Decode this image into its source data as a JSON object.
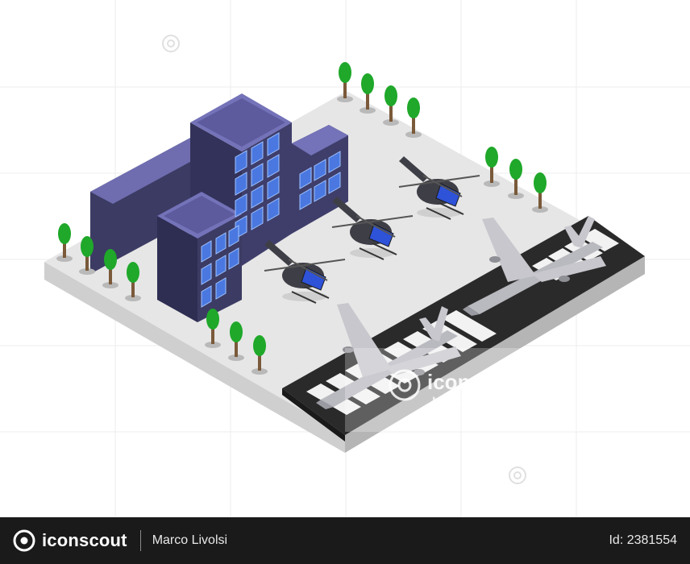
{
  "footer": {
    "brand": "iconscout",
    "author": "Marco Livolsi",
    "image_id": "Id: 2381554"
  },
  "watermark": {
    "brand": "iconscout",
    "author": "Marco Livolsi"
  },
  "colors": {
    "footer_bg": "#1a1a1a",
    "ground_top": "#e6e6e6",
    "ground_side": "#bdbdbd",
    "runway": "#2a2a2a",
    "building_front": "#3c3b63",
    "building_roof": "#6f6db0",
    "window": "#4a78e0",
    "tree": "#1fa82a",
    "helicopter_body": "#3e3e47",
    "cockpit": "#2e52d8",
    "plane": "#b9b9c0"
  },
  "icons": [
    "iconscout-logo-icon",
    "watermark-icon"
  ]
}
